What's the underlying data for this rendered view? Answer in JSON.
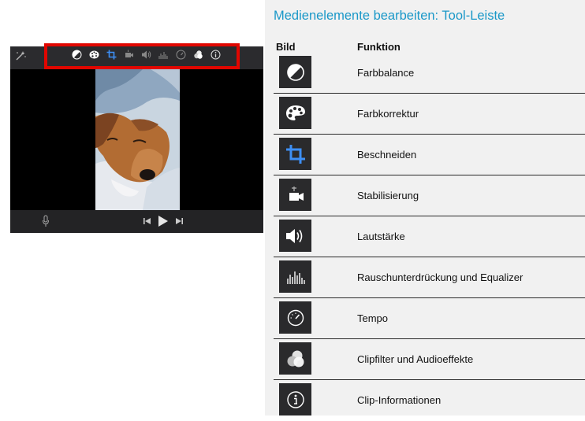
{
  "panel": {
    "title": "Medienelemente bearbeiten: Tool-Leiste",
    "col_image": "Bild",
    "col_function": "Funktion",
    "rows": [
      {
        "icon": "color-balance-icon",
        "label": "Farbbalance"
      },
      {
        "icon": "color-palette-icon",
        "label": "Farbkorrektur"
      },
      {
        "icon": "crop-icon",
        "label": "Beschneiden"
      },
      {
        "icon": "stabilization-camera-icon",
        "label": "Stabilisierung"
      },
      {
        "icon": "volume-icon",
        "label": "Lautstärke"
      },
      {
        "icon": "equalizer-icon",
        "label": "Rauschunterdrückung und Equalizer"
      },
      {
        "icon": "speedometer-icon",
        "label": "Tempo"
      },
      {
        "icon": "clip-filter-icon",
        "label": "Clipfilter und Audioeffekte"
      },
      {
        "icon": "info-icon",
        "label": "Clip-Informationen"
      }
    ]
  },
  "colors": {
    "title": "#1a98c8",
    "highlight": "#e10600",
    "crop_accent": "#3d8ff5",
    "icon_tile": "#2a2a2c"
  },
  "viewer": {
    "toolbar_icons": [
      "color-balance-icon",
      "color-palette-icon",
      "crop-icon",
      "stabilization-camera-icon",
      "volume-icon",
      "equalizer-icon",
      "speedometer-icon",
      "clip-filter-icon",
      "info-icon"
    ],
    "controls": [
      "microphone-icon",
      "skip-back-icon",
      "play-icon",
      "skip-forward-icon"
    ]
  }
}
